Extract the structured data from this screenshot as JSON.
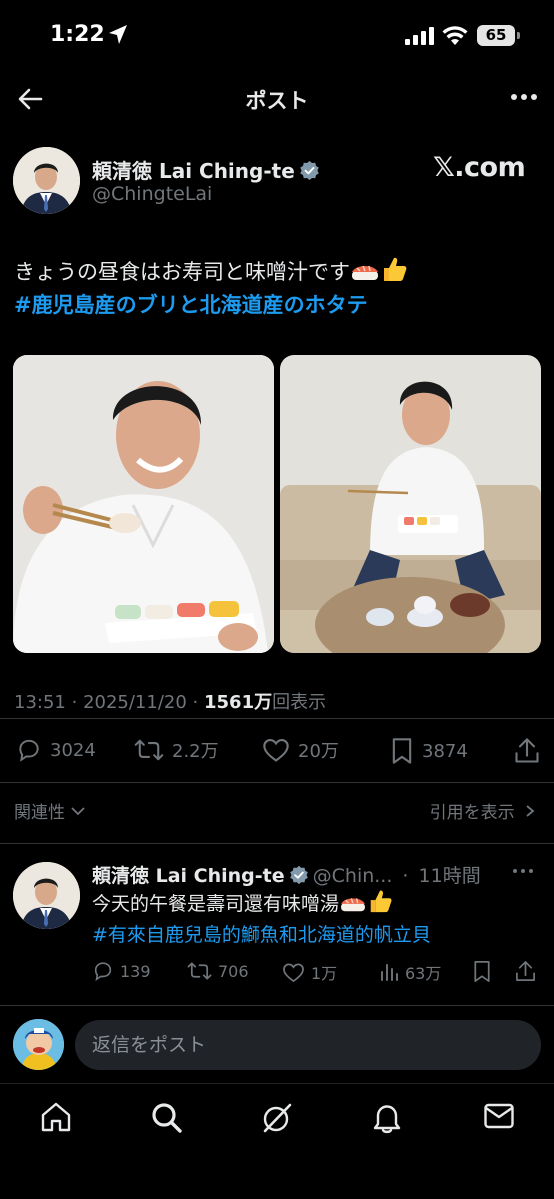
{
  "status": {
    "time": "1:22",
    "battery": "65"
  },
  "header": {
    "title": "ポスト"
  },
  "post": {
    "author_name": "頼清徳 Lai Ching-te",
    "author_handle": "@ChingteLai",
    "watermark": "𝕏.com",
    "text_line1": "きょうの昼食はお寿司と味噌汁です",
    "hashtag": "#鹿児島産のブリと北海道産のホタテ",
    "time": "13:51",
    "date": "2025/11/20",
    "views": "1561万",
    "views_label": "回表示",
    "replies": "3024",
    "reposts": "2.2万",
    "likes": "20万",
    "bookmarks": "3874"
  },
  "sort": {
    "label": "関連性",
    "quotes_label": "引用を表示"
  },
  "reply": {
    "author_name": "頼清徳 Lai Ching-te",
    "author_handle": "@Chin...",
    "age": "11時間",
    "text_line1": "今天的午餐是壽司還有味噌湯",
    "hashtag": "#有來自鹿兒島的鰤魚和北海道的帆立貝",
    "replies": "139",
    "reposts": "706",
    "likes": "1万",
    "views": "63万"
  },
  "composer": {
    "placeholder": "返信をポスト"
  },
  "colors": {
    "accent": "#1d9bf0",
    "text": "#e7e9ea",
    "muted": "#71767b",
    "background": "#000000"
  },
  "icons": [
    "back-arrow-icon",
    "more-icon",
    "verified-icon",
    "reply-icon",
    "repost-icon",
    "like-icon",
    "bookmark-icon",
    "share-icon",
    "views-icon",
    "home-icon",
    "search-icon",
    "grok-icon",
    "notifications-icon",
    "messages-icon"
  ]
}
